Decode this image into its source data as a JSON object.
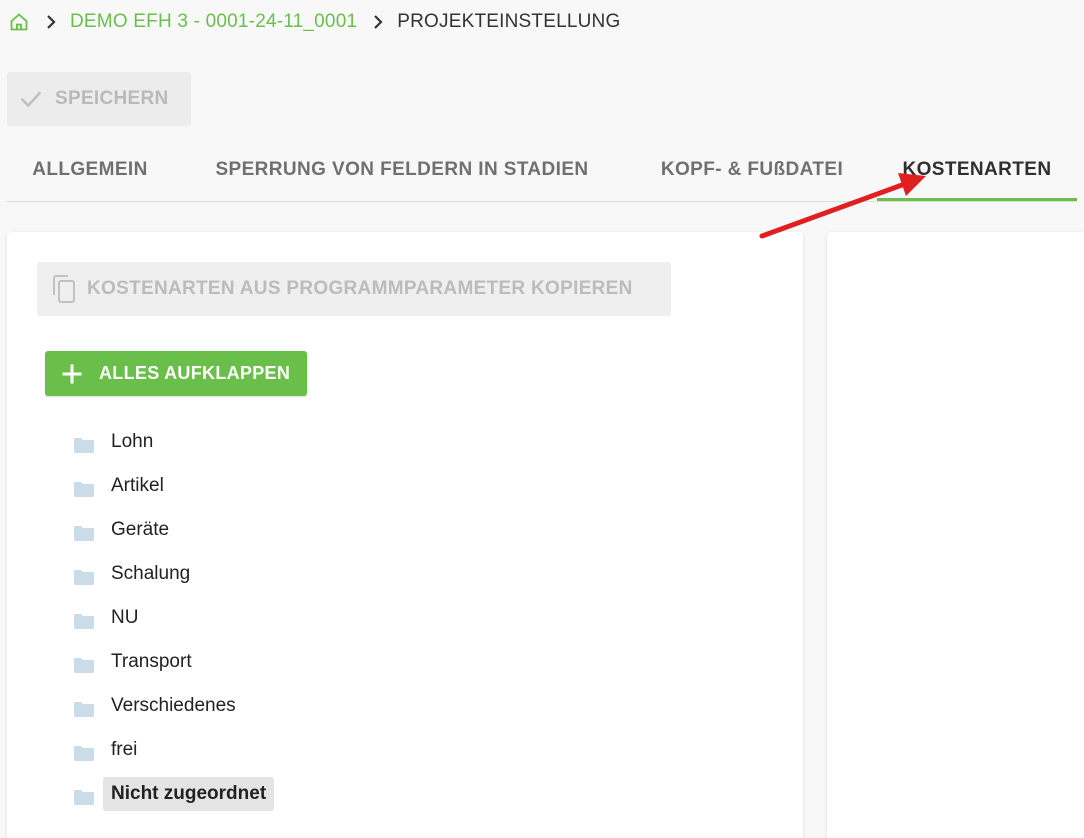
{
  "breadcrumb": {
    "project": "DEMO EFH 3 - 0001-24-11_0001",
    "current": "PROJEKTEINSTELLUNG"
  },
  "toolbar": {
    "save_label": "SPEICHERN"
  },
  "tabs": [
    {
      "label": "ALLGEMEIN"
    },
    {
      "label": "SPERRUNG VON FELDERN IN STADIEN"
    },
    {
      "label": "KOPF- & FUßDATEI"
    },
    {
      "label": "KOSTENARTEN"
    }
  ],
  "cost_types": {
    "copy_label": "KOSTENARTEN AUS PROGRAMMPARAMETER KOPIEREN",
    "expand_label": "ALLES AUFKLAPPEN",
    "items": [
      {
        "label": "Lohn"
      },
      {
        "label": "Artikel"
      },
      {
        "label": "Geräte"
      },
      {
        "label": "Schalung"
      },
      {
        "label": "NU"
      },
      {
        "label": "Transport"
      },
      {
        "label": "Verschiedenes"
      },
      {
        "label": "frei"
      },
      {
        "label": "Nicht zugeordnet"
      }
    ]
  },
  "colors": {
    "accent": "#6abf4b",
    "annotation": "#e02020",
    "folder": "#c9dce8"
  }
}
